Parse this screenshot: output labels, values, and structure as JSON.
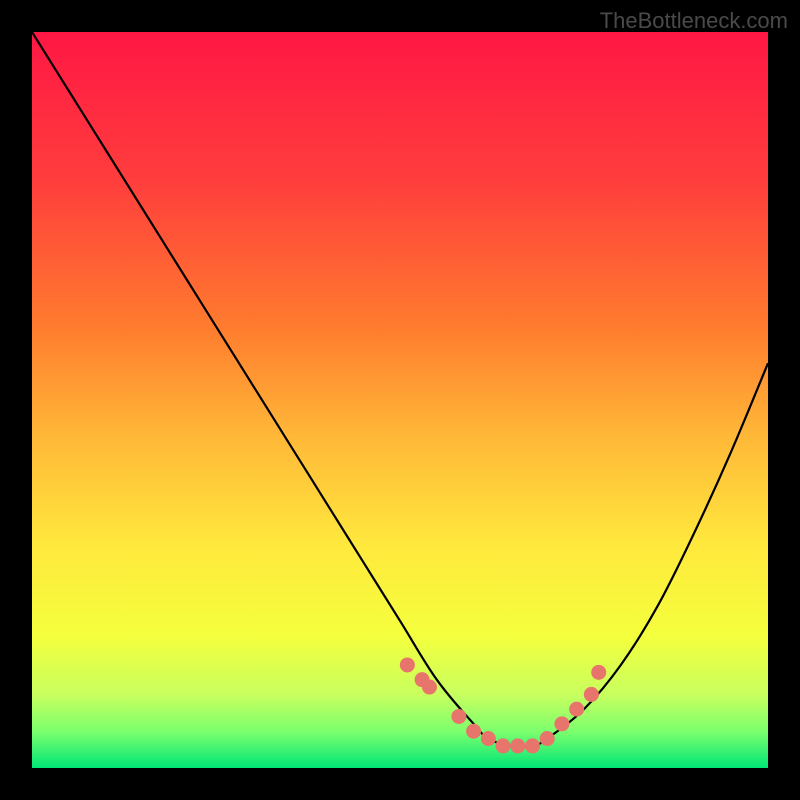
{
  "watermark": "TheBottleneck.com",
  "chart_data": {
    "type": "line",
    "title": "",
    "xlabel": "",
    "ylabel": "",
    "xlim": [
      0,
      100
    ],
    "ylim": [
      0,
      100
    ],
    "series": [
      {
        "name": "bottleneck-curve",
        "x": [
          0,
          5,
          10,
          15,
          20,
          25,
          30,
          35,
          40,
          45,
          50,
          55,
          60,
          62,
          65,
          68,
          70,
          75,
          80,
          85,
          90,
          95,
          100
        ],
        "y": [
          100,
          92,
          84,
          76,
          68,
          60,
          52,
          44,
          36,
          28,
          20,
          12,
          6,
          4,
          3,
          3,
          4,
          8,
          14,
          22,
          32,
          43,
          55
        ]
      }
    ],
    "highlighted_points": {
      "name": "marked-dots",
      "x": [
        51,
        53,
        54,
        58,
        60,
        62,
        64,
        66,
        68,
        70,
        72,
        74,
        76,
        77
      ],
      "y": [
        14,
        12,
        11,
        7,
        5,
        4,
        3,
        3,
        3,
        4,
        6,
        8,
        10,
        13
      ]
    },
    "gradient_stops": [
      {
        "offset": 0,
        "color": "#ff1744"
      },
      {
        "offset": 20,
        "color": "#ff3d3d"
      },
      {
        "offset": 40,
        "color": "#ff7b2e"
      },
      {
        "offset": 55,
        "color": "#ffb838"
      },
      {
        "offset": 70,
        "color": "#ffe93d"
      },
      {
        "offset": 82,
        "color": "#f4ff3d"
      },
      {
        "offset": 90,
        "color": "#c8ff5e"
      },
      {
        "offset": 95,
        "color": "#7dff6e"
      },
      {
        "offset": 100,
        "color": "#00e676"
      }
    ],
    "dot_color": "#e8756b",
    "curve_color": "#000000"
  }
}
